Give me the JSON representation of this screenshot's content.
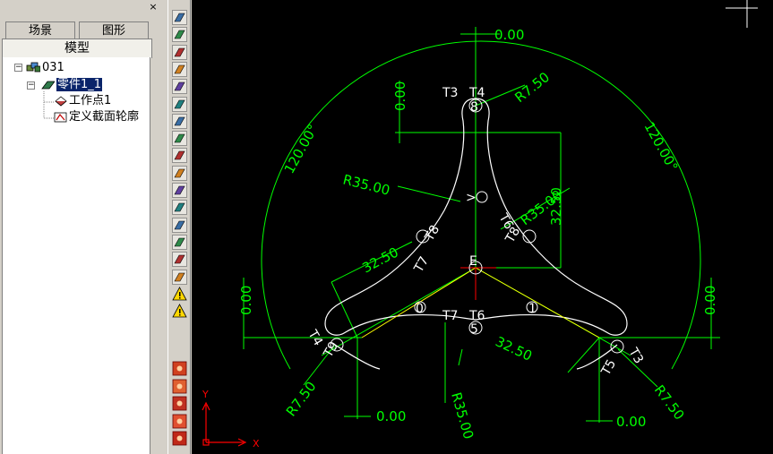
{
  "panel": {
    "close_glyph": "×",
    "tabs": {
      "scene": "场景",
      "graphics": "图形",
      "model": "模型"
    },
    "tree": {
      "root": "031",
      "part": "零件1_1",
      "work_point": "工作点1",
      "section": "定义截面轮廓",
      "expand_glyph": "−"
    }
  },
  "toolbar": {
    "top_tools": [
      "sketch-icon",
      "extrude-icon",
      "plane-icon",
      "revolve-icon",
      "loft-icon",
      "shell-icon",
      "hole-icon",
      "pattern-icon",
      "mirror-icon",
      "fillet-icon",
      "chamfer-icon",
      "draft-icon",
      "edit-icon",
      "measure-icon",
      "sweep-icon",
      "solid-icon",
      "warning-icon",
      "warning-icon"
    ],
    "bottom_tools": [
      "color-1-icon",
      "color-2-icon",
      "color-3-icon",
      "color-4-icon",
      "color-5-icon"
    ]
  },
  "drawing": {
    "colors": {
      "background": "#000000",
      "dimension": "#00ff00",
      "profile": "#ffffff",
      "axis_red": "#ff0000",
      "constraint": "#ffff00"
    },
    "dimensions": {
      "top_zero": "0.00",
      "left_top_zero": "0.00",
      "left_zero": "0.00",
      "right_zero": "0.00",
      "bottom_left_zero": "0.00",
      "bottom_right_zero": "0.00",
      "r_top": "R7.50",
      "r_left_outer": "R7.50",
      "r_right_outer": "R7.50",
      "r35_left": "R35.00",
      "r35_right": "R35.00",
      "r35_bottom": "R35.00",
      "ang_left": "120.00°",
      "ang_right": "120.00°",
      "len_vertical": "32.50",
      "len_left": "32.50",
      "len_right": "32.50"
    },
    "labels": {
      "t3": "T3",
      "t4": "T4",
      "t7": "T7",
      "t6": "T6",
      "t4_left": "T4",
      "t5": "T5",
      "t6_rot": "T6",
      "t7_rot": "T7",
      "t8_a": "T8",
      "t8_b": "T8",
      "t3_rot": "T3",
      "t9": "T9",
      "p0": "0",
      "p1": "1",
      "p5": "5",
      "p8": "8",
      "pE": "E"
    },
    "axes": {
      "x": "X",
      "y": "Y"
    }
  }
}
